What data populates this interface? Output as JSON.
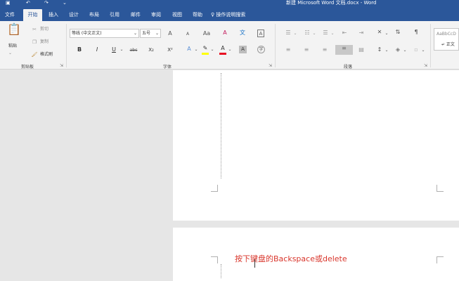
{
  "titlebar": {
    "title": "新建 Microsoft Word 文档.docx  -  Word",
    "save_icon": "save-icon",
    "undo_icon": "undo-icon",
    "redo_icon": "redo-icon",
    "customize_icon": "customize-icon"
  },
  "tabs": [
    "文件",
    "开始",
    "插入",
    "设计",
    "布局",
    "引用",
    "邮件",
    "审阅",
    "视图",
    "帮助"
  ],
  "active_tab": "开始",
  "tellme": {
    "label": "操作说明搜索",
    "icon": "lightbulb-icon"
  },
  "clipboard": {
    "paste_label": "粘贴",
    "cut_label": "剪切",
    "copy_label": "复制",
    "format_painter_label": "格式刷",
    "group_label": "剪贴板"
  },
  "font": {
    "font_name": "等线 (中文正文)",
    "font_size": "五号",
    "bold": "B",
    "italic": "I",
    "underline": "U",
    "strike": "abc",
    "subscript": "X₂",
    "superscript": "X²",
    "grow": "A",
    "shrink": "A",
    "change_case": "Aa",
    "clear_format": "A",
    "phonetic": "文",
    "char_border": "A",
    "font_color_letter": "A",
    "char_shading": "A",
    "enclose": "字",
    "group_label": "字体"
  },
  "paragraph": {
    "group_label": "段落"
  },
  "styles": {
    "preview": "AaBbCcD",
    "label": "↵ 正文"
  },
  "document": {
    "text": "按下键盘的Backspace或delete"
  },
  "colors": {
    "accent": "#2b579a",
    "font_color_bar": "#e81123",
    "highlight_bar": "#ffff00",
    "doc_text": "#d9362c"
  }
}
